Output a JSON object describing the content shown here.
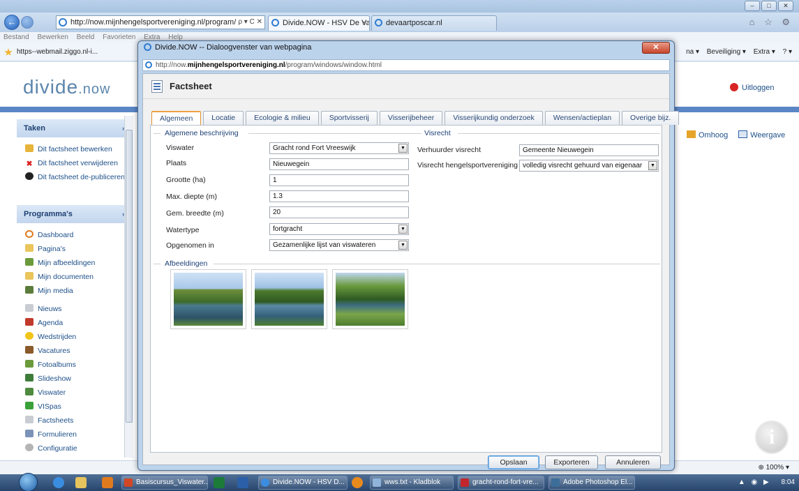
{
  "browser": {
    "window_controls": [
      "–",
      "□",
      "✕"
    ],
    "address_url": "http://now.mijnhengelsportvereniging.nl/program/defi",
    "address_buttons": "ρ ▾ C ✕",
    "tabs": [
      {
        "label": "Divide.NOW - HSV De Vaart...",
        "close": "×"
      },
      {
        "label": "devaartposcar.nl"
      }
    ],
    "right_icons": "⌂ ☆ ⚙",
    "menu": [
      "Bestand",
      "Bewerken",
      "Beeld",
      "Favorieten",
      "Extra",
      "Help"
    ],
    "favorite_link": "https--webmail.ziggo.nl-i...",
    "toolbar": [
      "na ▾",
      "Beveiliging ▾",
      "Extra ▾",
      "? ▾"
    ]
  },
  "page": {
    "logo_main": "divide",
    "logo_suffix": ".now",
    "logout": "Uitloggen",
    "panels": {
      "taken": {
        "title": "Taken",
        "chevron": "»",
        "items": [
          "Dit factsheet bewerken",
          "Dit factsheet verwijderen",
          "Dit factsheet de-publiceren"
        ]
      },
      "programmas": {
        "title": "Programma's",
        "chevron": "»",
        "items": [
          "Dashboard",
          "Pagina's",
          "Mijn afbeeldingen",
          "Mijn documenten",
          "Mijn media",
          "Nieuws",
          "Agenda",
          "Wedstrijden",
          "Vacatures",
          "Fotoalbums",
          "Slideshow",
          "Viswater",
          "VISpas",
          "Factsheets",
          "Formulieren",
          "Configuratie"
        ]
      }
    },
    "omhoog": "Omhoog",
    "weergave": "Weergave",
    "info_icon": "i",
    "zoom": "100%"
  },
  "dialog": {
    "title": "Divide.NOW -- Dialoogvenster van webpagina",
    "close": "✕",
    "url_prefix": "http://now.",
    "url_domain": "mijnhengelsportvereniging.nl",
    "url_path": "/program/windows/window.html",
    "heading": "Factsheet",
    "tabs": [
      "Algemeen",
      "Locatie",
      "Ecologie & milieu",
      "Sportvisserij",
      "Visserijbeheer",
      "Visserijkundig onderzoek",
      "Wensen/actieplan",
      "Overige bijz."
    ],
    "sections": {
      "general": "Algemene beschrijving",
      "fishing_rights": "Visrecht",
      "images": "Afbeeldingen"
    },
    "fields": {
      "viswater": {
        "label": "Viswater",
        "value": "Gracht rond Fort Vreeswijk"
      },
      "plaats": {
        "label": "Plaats",
        "value": "Nieuwegein"
      },
      "grootte": {
        "label": "Grootte (ha)",
        "value": "1"
      },
      "max_diepte": {
        "label": "Max. diepte (m)",
        "value": "1.3"
      },
      "gem_breedte": {
        "label": "Gem. breedte (m)",
        "value": "20"
      },
      "watertype": {
        "label": "Watertype",
        "value": "fortgracht"
      },
      "opgenomen_in": {
        "label": "Opgenomen in",
        "value": "Gezamenlijke lijst van viswateren"
      },
      "verhuurder": {
        "label": "Verhuurder visrecht",
        "value": "Gemeente Nieuwegein"
      },
      "visrecht_hsv": {
        "label": "Visrecht hengelsportvereniging",
        "value": "volledig visrecht gehuurd van eigenaar"
      }
    },
    "dropdown_arrow": "▼",
    "buttons": {
      "save": "Opslaan",
      "export": "Exporteren",
      "cancel": "Annuleren"
    }
  },
  "taskbar": {
    "items": [
      "Basiscursus_Viswater...",
      "Divide.NOW - HSV D...",
      "wws.txt - Kladblok",
      "gracht-rond-fort-vre...",
      "Adobe Photoshop El..."
    ],
    "tray_symbols": "▲ ◉ ▶",
    "time": "8:04"
  }
}
